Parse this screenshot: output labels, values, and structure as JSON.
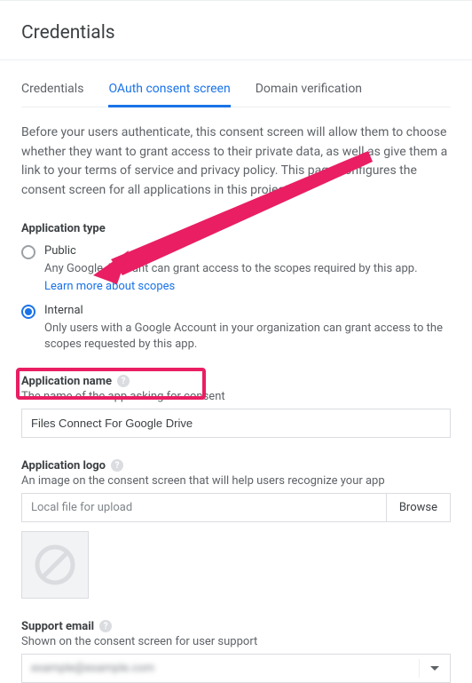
{
  "header": {
    "title": "Credentials"
  },
  "tabs": {
    "items": [
      {
        "label": "Credentials",
        "active": false
      },
      {
        "label": "OAuth consent screen",
        "active": true
      },
      {
        "label": "Domain verification",
        "active": false
      }
    ]
  },
  "intro": "Before your users authenticate, this consent screen will allow them to choose whether they want to grant access to their private data, as well as give them a link to your terms of service and privacy policy. This page configures the consent screen for all applications in this project.",
  "appType": {
    "label": "Application type",
    "options": [
      {
        "title": "Public",
        "desc": "Any Google Account can grant access to the scopes required by this app.",
        "learn": "Learn more about scopes",
        "selected": false
      },
      {
        "title": "Internal",
        "desc": "Only users with a Google Account in your organization can grant access to the scopes requested by this app.",
        "selected": true
      }
    ]
  },
  "appName": {
    "label": "Application name",
    "sub": "The name of the app asking for consent",
    "value": "Files Connect For Google Drive"
  },
  "appLogo": {
    "label": "Application logo",
    "sub": "An image on the consent screen that will help users recognize your app",
    "placeholder": "Local file for upload",
    "browse": "Browse"
  },
  "supportEmail": {
    "label": "Support email",
    "sub": "Shown on the consent screen for user support",
    "value": "example@example.com"
  }
}
